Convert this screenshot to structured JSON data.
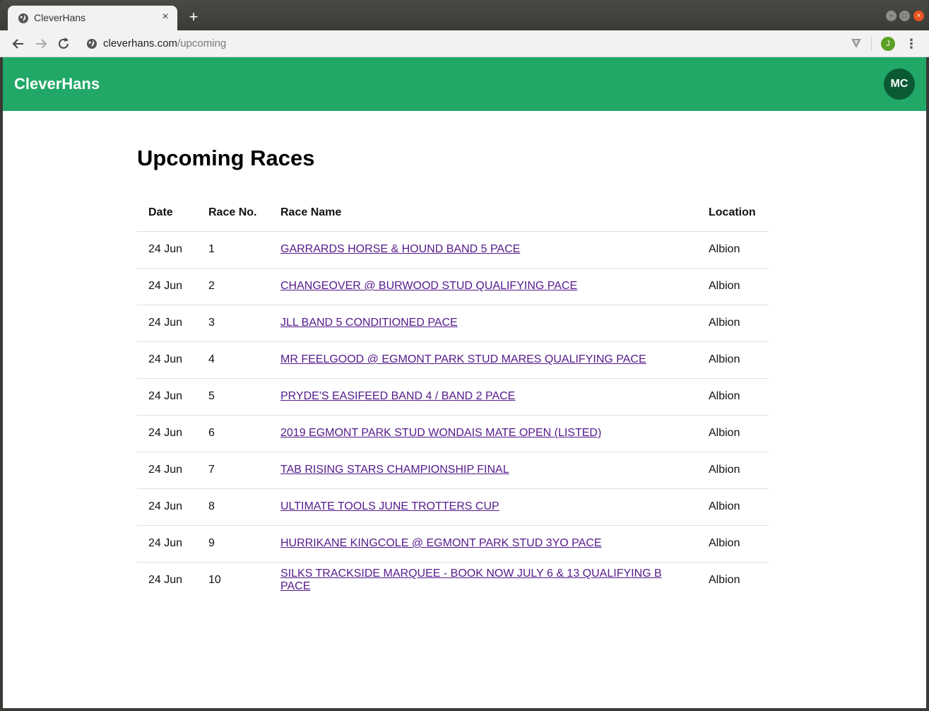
{
  "browser": {
    "tab_title": "CleverHans",
    "new_tab_label": "+",
    "close_tab_label": "×",
    "url_host": "cleverhans.com",
    "url_path": "/upcoming",
    "profile_initial": "J",
    "menu_label": "⋮"
  },
  "app": {
    "brand": "CleverHans",
    "avatar_initials": "MC",
    "accent_color": "#21a867"
  },
  "main": {
    "title": "Upcoming Races",
    "columns": [
      "Date",
      "Race No.",
      "Race Name",
      "Location"
    ],
    "rows": [
      {
        "date": "24 Jun",
        "no": "1",
        "name": "GARRARDS HORSE & HOUND BAND 5 PACE",
        "location": "Albion"
      },
      {
        "date": "24 Jun",
        "no": "2",
        "name": "CHANGEOVER @ BURWOOD STUD QUALIFYING PACE",
        "location": "Albion"
      },
      {
        "date": "24 Jun",
        "no": "3",
        "name": "JLL BAND 5 CONDITIONED PACE",
        "location": "Albion"
      },
      {
        "date": "24 Jun",
        "no": "4",
        "name": "MR FEELGOOD @ EGMONT PARK STUD MARES QUALIFYING PACE",
        "location": "Albion"
      },
      {
        "date": "24 Jun",
        "no": "5",
        "name": "PRYDE'S EASIFEED BAND 4 / BAND 2 PACE",
        "location": "Albion"
      },
      {
        "date": "24 Jun",
        "no": "6",
        "name": "2019 EGMONT PARK STUD WONDAIS MATE OPEN (LISTED)",
        "location": "Albion"
      },
      {
        "date": "24 Jun",
        "no": "7",
        "name": "TAB RISING STARS CHAMPIONSHIP FINAL",
        "location": "Albion"
      },
      {
        "date": "24 Jun",
        "no": "8",
        "name": "ULTIMATE TOOLS JUNE TROTTERS CUP",
        "location": "Albion"
      },
      {
        "date": "24 Jun",
        "no": "9",
        "name": "HURRIKANE KINGCOLE @ EGMONT PARK STUD 3YO PACE",
        "location": "Albion"
      },
      {
        "date": "24 Jun",
        "no": "10",
        "name": "SILKS TRACKSIDE MARQUEE - BOOK NOW JULY 6 & 13 QUALIFYING B PACE",
        "location": "Albion"
      }
    ]
  }
}
